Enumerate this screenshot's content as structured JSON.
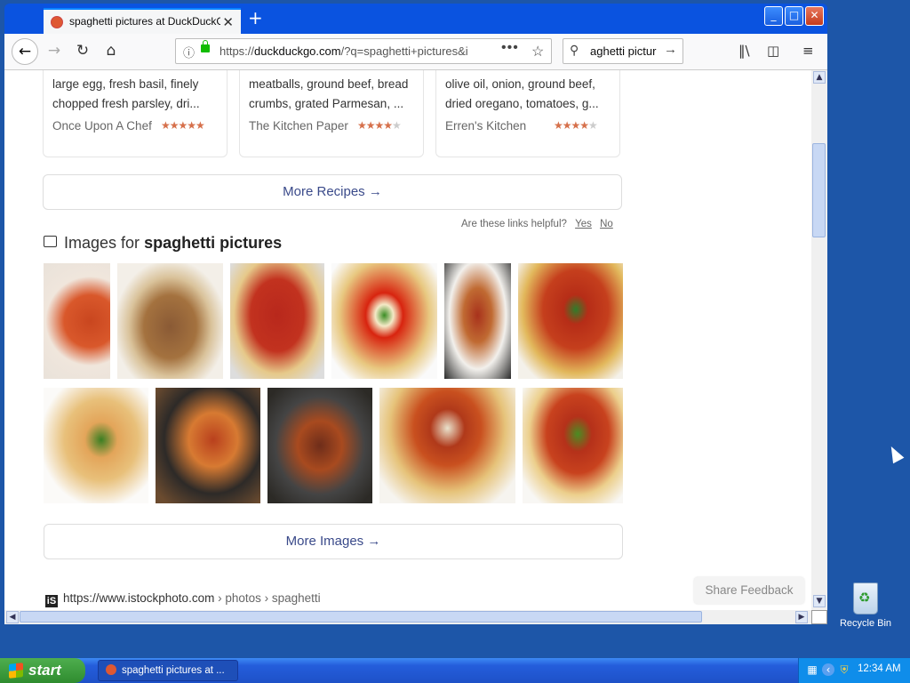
{
  "browser": {
    "tab_title": "spaghetti pictures at DuckDuckGo",
    "tab_close": "✕",
    "new_tab": "+",
    "url_prefix": "https://",
    "url_host": "duckduckgo.com",
    "url_rest": "/?q=spaghetti+pictures&i",
    "page_actions": "•••",
    "search_value": "aghetti pictur"
  },
  "recipes": [
    {
      "desc": "large egg, fresh basil, finely chopped fresh parsley, dri...",
      "source": "Once Upon A Chef",
      "rating": 5
    },
    {
      "desc": "meatballs, ground beef, bread crumbs, grated Parmesan, ...",
      "source": "The Kitchen Paper",
      "rating": 4
    },
    {
      "desc": "olive oil, onion, ground beef, dried oregano, tomatoes, g...",
      "source": "Erren's Kitchen",
      "rating": 4
    }
  ],
  "more_recipes": "More Recipes  →",
  "helpful": {
    "question": "Are these links helpful?",
    "yes": "Yes",
    "no": "No"
  },
  "images_section": {
    "prefix": "Images for",
    "query": "spaghetti pictures"
  },
  "more_images": "More Images  →",
  "result_url": {
    "favicon": "iS",
    "host": "https://www.istockphoto.com",
    "path": " › photos › spaghetti"
  },
  "share_feedback": "Share Feedback",
  "desktop": {
    "recycle_bin": "Recycle Bin"
  },
  "taskbar": {
    "start": "start",
    "task": "spaghetti pictures at ...",
    "clock": "12:34 AM"
  }
}
